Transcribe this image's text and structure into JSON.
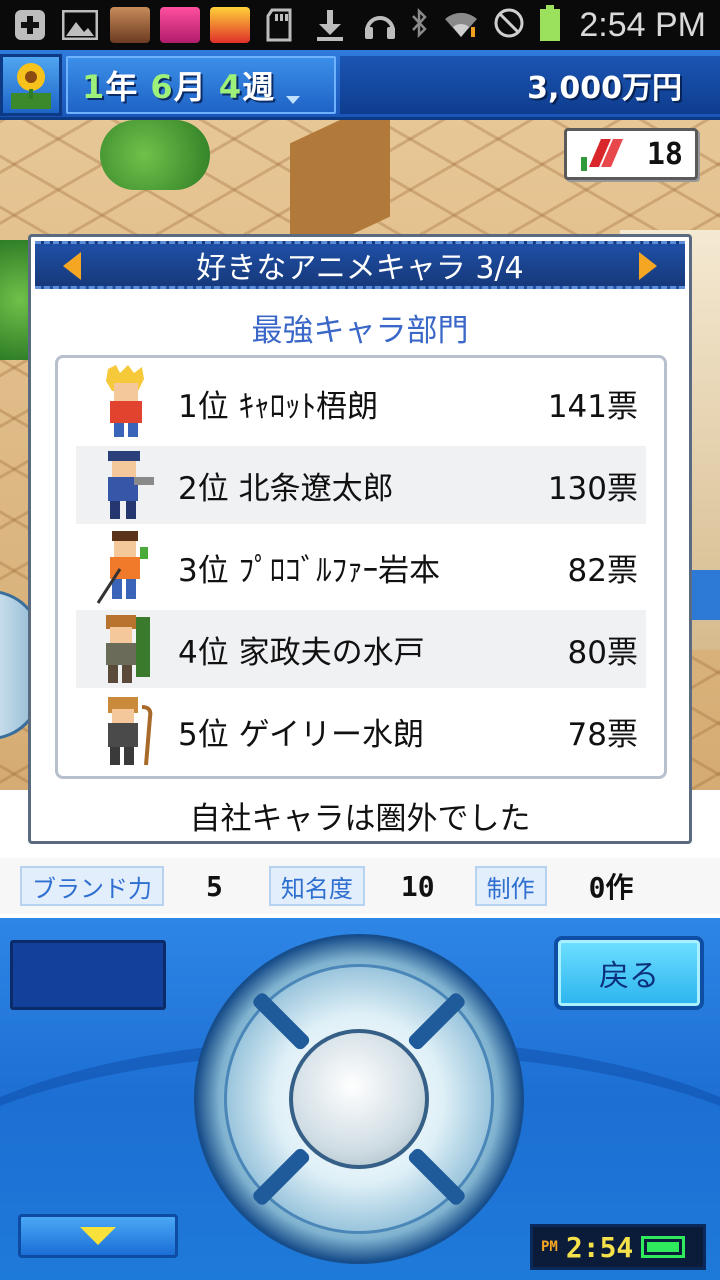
{
  "status_bar": {
    "time": "2:54 PM",
    "left_icons": [
      "plus-icon",
      "image-icon",
      "app-thumb-1",
      "app-thumb-2",
      "app-thumb-3",
      "sd-card-icon",
      "download-icon",
      "headset-icon"
    ],
    "right_icons": [
      "bluetooth-icon",
      "wifi-icon",
      "no-signal-icon",
      "battery-icon"
    ]
  },
  "header": {
    "date_year": "1",
    "date_year_suffix": "年",
    "date_month": "6",
    "date_month_suffix": "月",
    "date_week": "4",
    "date_week_suffix": "週",
    "money": "3,000万円"
  },
  "book_counter": {
    "value": "18"
  },
  "dialog": {
    "title": "好きなアニメキャラ 3/4",
    "subtitle": "最強キャラ部門",
    "rankings": [
      {
        "rank_name": "1位 ｷｬﾛｯﾄ梧朗",
        "votes": "141票"
      },
      {
        "rank_name": "2位 北条遼太郎",
        "votes": "130票"
      },
      {
        "rank_name": "3位 ﾌﾟﾛｺﾞﾙﾌｧｰ岩本",
        "votes": "82票"
      },
      {
        "rank_name": "4位 家政夫の水戸",
        "votes": "80票"
      },
      {
        "rank_name": "5位 ゲイリー水朗",
        "votes": "78票"
      }
    ],
    "footer": "自社キャラは圏外でした"
  },
  "stats": {
    "brand_label": "ブランド力",
    "brand_value": "5",
    "fame_label": "知名度",
    "fame_value": "10",
    "production_label": "制作",
    "production_value": "0作"
  },
  "controls": {
    "back_label": "戻る",
    "clock_ampm": "PM",
    "clock_time": "2:54"
  },
  "colors": {
    "header_blue": "#1a56b8",
    "panel_blue": "#1d6fd3",
    "subtitle_blue": "#3a67c8",
    "arrow_orange": "#f5a623"
  }
}
